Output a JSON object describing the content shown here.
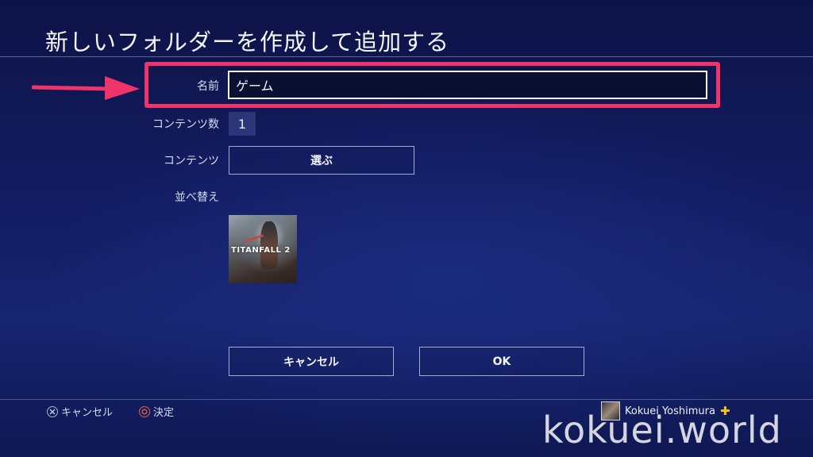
{
  "header": {
    "title": "新しいフォルダーを作成して追加する"
  },
  "form": {
    "name": {
      "label": "名前",
      "value": "ゲーム"
    },
    "content_count": {
      "label": "コンテンツ数",
      "value": "1"
    },
    "contents": {
      "label": "コンテンツ",
      "button_label": "選ぶ"
    },
    "sort": {
      "label": "並べ替え"
    },
    "items": [
      {
        "title": "TITANFALL 2"
      }
    ]
  },
  "actions": {
    "cancel_label": "キャンセル",
    "ok_label": "OK"
  },
  "hints": {
    "cancel": {
      "icon": "cross-button-icon",
      "label": "キャンセル"
    },
    "decide": {
      "icon": "circle-button-icon",
      "label": "決定"
    }
  },
  "user": {
    "name": "Kokuei Yoshimura",
    "badge": "plus-icon"
  },
  "annotation": {
    "highlight_color": "#f0336b"
  },
  "watermark": "kokuei.world"
}
